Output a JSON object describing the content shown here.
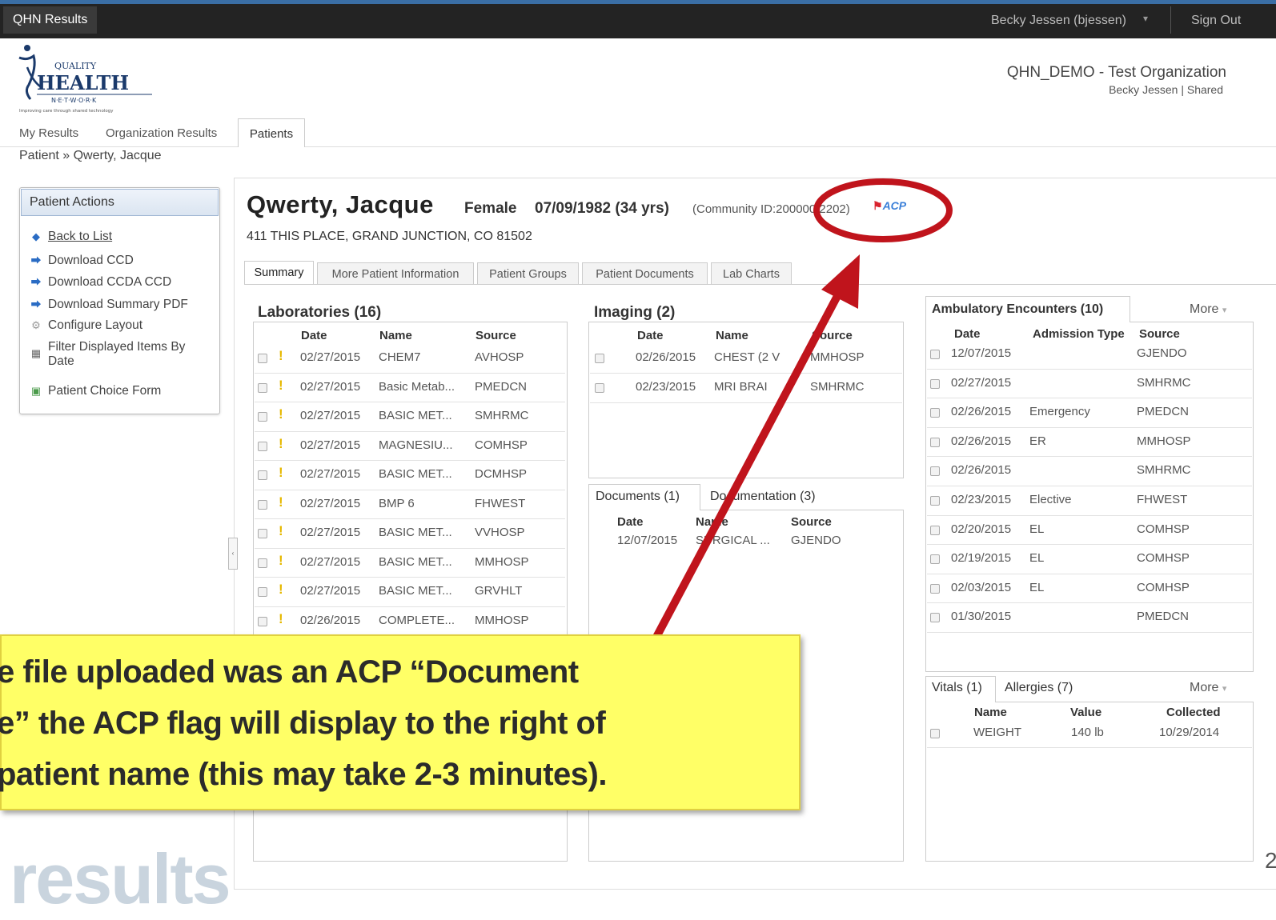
{
  "app": {
    "name": "QHN Results",
    "user_menu": "Becky Jessen (bjessen)",
    "sign_out": "Sign Out"
  },
  "org": {
    "name": "QHN_DEMO - Test Organization",
    "user_line": "Becky Jessen | Shared"
  },
  "logo": {
    "line1": "QUALITY",
    "line2": "HEALTH",
    "line3": "N·E·T·W·O·R·K",
    "tagline": "Improving care through shared technology"
  },
  "nav": {
    "my_results": "My Results",
    "org_results": "Organization Results",
    "patients": "Patients"
  },
  "breadcrumb": "Patient » Qwerty, Jacque",
  "actions": {
    "title": "Patient Actions",
    "items": [
      {
        "label": "Back to List",
        "icon": "back-arrow-icon"
      },
      {
        "label": "Download CCD",
        "icon": "download-icon"
      },
      {
        "label": "Download CCDA CCD",
        "icon": "download-icon"
      },
      {
        "label": "Download Summary PDF",
        "icon": "download-icon"
      },
      {
        "label": "Configure Layout",
        "icon": "gear-icon"
      },
      {
        "label": "Filter Displayed Items By Date",
        "icon": "calendar-icon"
      },
      {
        "label": "Patient Choice Form",
        "icon": "form-icon"
      }
    ]
  },
  "patient": {
    "name": "Qwerty, Jacque",
    "gender": "Female",
    "dob": "07/09/1982 (34 yrs)",
    "community_id": "(Community ID:200000  2202)",
    "acp_flag": "ACP",
    "address": "411 THIS PLACE, GRAND JUNCTION, CO 81502"
  },
  "tabs": [
    "Summary",
    "More Patient Information",
    "Patient Groups",
    "Patient Documents",
    "Lab Charts"
  ],
  "labs": {
    "title": "Laboratories (16)",
    "headers": [
      "Date",
      "Name",
      "Source"
    ],
    "rows": [
      [
        "02/27/2015",
        "CHEM7",
        "AVHOSP"
      ],
      [
        "02/27/2015",
        "Basic Metab...",
        "PMEDCN"
      ],
      [
        "02/27/2015",
        "BASIC MET...",
        "SMHRMC"
      ],
      [
        "02/27/2015",
        "MAGNESIU...",
        "COMHSP"
      ],
      [
        "02/27/2015",
        "BASIC MET...",
        "DCMHSP"
      ],
      [
        "02/27/2015",
        "BMP 6",
        "FHWEST"
      ],
      [
        "02/27/2015",
        "BASIC MET...",
        "VVHOSP"
      ],
      [
        "02/27/2015",
        "BASIC MET...",
        "MMHOSP"
      ],
      [
        "02/27/2015",
        "BASIC MET...",
        "GRVHLT"
      ],
      [
        "02/26/2015",
        "COMPLETE...",
        "MMHOSP"
      ]
    ]
  },
  "imaging": {
    "title": "Imaging (2)",
    "headers": [
      "Date",
      "Name",
      "Source"
    ],
    "rows": [
      [
        "02/26/2015",
        "CHEST (2 V",
        "MMHOSP"
      ],
      [
        "02/23/2015",
        "MRI BRAI",
        "SMHRMC"
      ]
    ]
  },
  "documents": {
    "tab1": "Documents (1)",
    "tab2": "Documentation (3)",
    "headers": [
      "Date",
      "Name",
      "Source"
    ],
    "rows": [
      [
        "12/07/2015",
        "SURGICAL ...",
        "GJENDO"
      ]
    ]
  },
  "encounters": {
    "title": "Ambulatory Encounters (10)",
    "more": "More",
    "headers": [
      "Date",
      "Admission Type",
      "Source"
    ],
    "rows": [
      [
        "12/07/2015",
        "",
        "GJENDO"
      ],
      [
        "02/27/2015",
        "",
        "SMHRMC"
      ],
      [
        "02/26/2015",
        "Emergency",
        "PMEDCN"
      ],
      [
        "02/26/2015",
        "ER",
        "MMHOSP"
      ],
      [
        "02/26/2015",
        "",
        "SMHRMC"
      ],
      [
        "02/23/2015",
        "Elective",
        "FHWEST"
      ],
      [
        "02/20/2015",
        "EL",
        "COMHSP"
      ],
      [
        "02/19/2015",
        "EL",
        "COMHSP"
      ],
      [
        "02/03/2015",
        "EL",
        "COMHSP"
      ],
      [
        "01/30/2015",
        "",
        "PMEDCN"
      ]
    ]
  },
  "vitals": {
    "tab1": "Vitals (1)",
    "tab2": "Allergies (7)",
    "more": "More",
    "headers": [
      "Name",
      "Value",
      "Collected"
    ],
    "rows": [
      [
        "WEIGHT",
        "140 lb",
        "10/29/2014"
      ]
    ]
  },
  "callout": {
    "line1": "e file uploaded was an ACP “Document",
    "line2": "e” the ACP flag will display to the right of",
    "line3": "patient name (this may take 2-3 minutes)."
  },
  "watermark": "results",
  "page_number": "2",
  "colors": {
    "topbar": "#232323",
    "accent": "#3a6ea5",
    "annotation_red": "#c0141c",
    "callout_bg": "#ffff66"
  }
}
